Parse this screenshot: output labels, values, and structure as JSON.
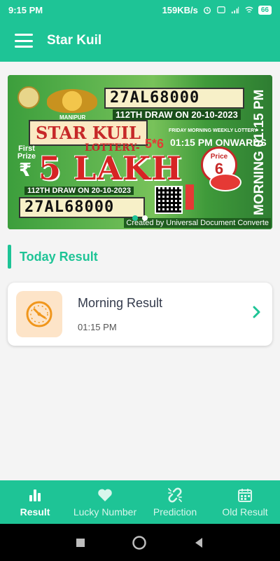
{
  "status": {
    "time": "9:15 PM",
    "net_speed": "159KB/s",
    "battery": "66"
  },
  "app_bar": {
    "title": "Star Kuil"
  },
  "banner": {
    "ticket_number_top": "27AL68000",
    "ticket_number_bottom": "27AL68000",
    "draw_text_top": "112TH DRAW ON 20-10-2023",
    "draw_text_bottom": "112TH DRAW ON 20-10-2023",
    "state": "MANIPUR",
    "brand": "STAR KUIL",
    "lottery_label": "LOTTERY-",
    "series": "5*6",
    "first_prize_label": "First Prize",
    "rupee_symbol": "₹",
    "amount": "5 LAKH",
    "weekly_label": "FRIDAY MORNING WEEKLY LOTTERY",
    "onwards": "01:15 PM ONWARDS",
    "price_label": "Price",
    "price_value": "6",
    "vertical_time": "MORNING 01:15 PM",
    "watermark": "Created by Universal Document Converte",
    "slides": 2,
    "active_slide": 0
  },
  "today": {
    "section_title": "Today Result",
    "result_title": "Morning Result",
    "result_time": "01:15 PM"
  },
  "nav": {
    "items": [
      {
        "label": "Result",
        "icon": "bar-chart-icon"
      },
      {
        "label": "Lucky Number",
        "icon": "heart-icon"
      },
      {
        "label": "Prediction",
        "icon": "broken-link-icon"
      },
      {
        "label": "Old Result",
        "icon": "calendar-icon"
      }
    ],
    "active": 0
  },
  "colors": {
    "primary": "#1ec496",
    "card_icon_bg": "#fde4c8",
    "clock": "#f0961c"
  }
}
